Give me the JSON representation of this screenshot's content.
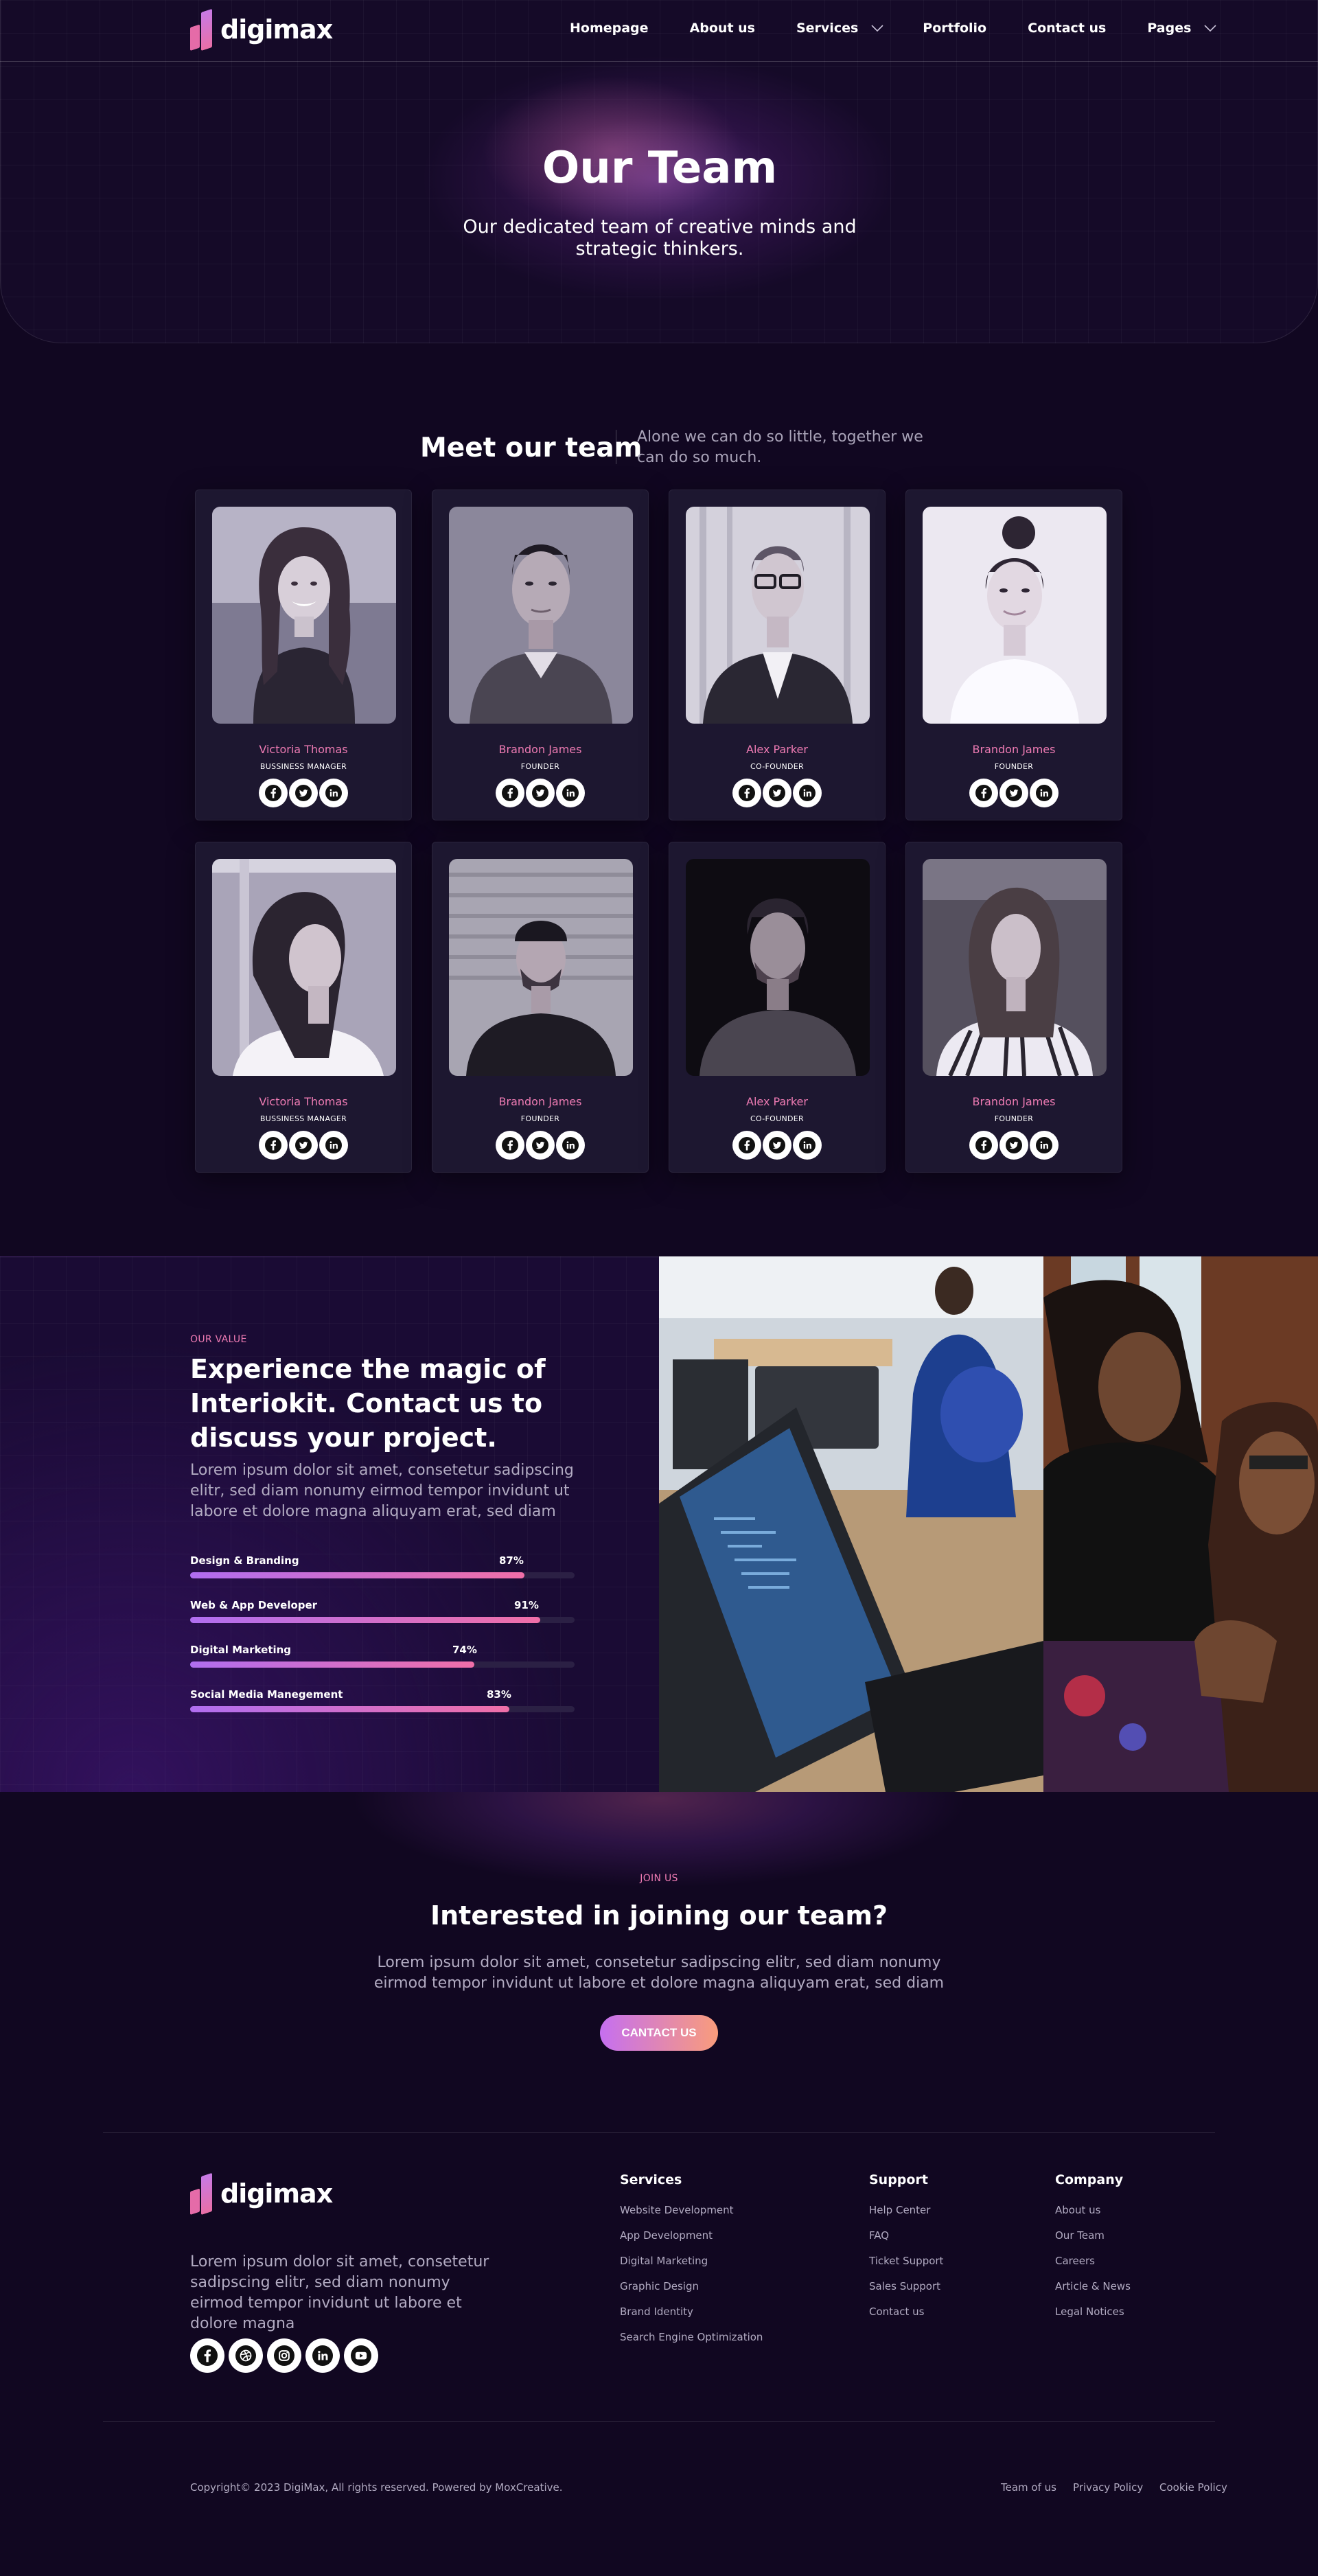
{
  "brand": {
    "name": "digimax"
  },
  "nav": {
    "items": [
      {
        "label": "Homepage",
        "dropdown": false
      },
      {
        "label": "About us",
        "dropdown": false
      },
      {
        "label": "Services",
        "dropdown": true
      },
      {
        "label": "Portfolio",
        "dropdown": false
      },
      {
        "label": "Contact us",
        "dropdown": false
      },
      {
        "label": "Pages",
        "dropdown": true
      }
    ]
  },
  "hero": {
    "title": "Our Team",
    "subtitle": "Our dedicated team of creative minds and strategic thinkers."
  },
  "team": {
    "title": "Meet our team",
    "description": "Alone we can do so little, together we can do so much.",
    "members": [
      {
        "name": "Victoria Thomas",
        "role": "BUSSINESS MANAGER"
      },
      {
        "name": "Brandon James",
        "role": "FOUNDER"
      },
      {
        "name": "Alex Parker",
        "role": "CO-FOUNDER"
      },
      {
        "name": "Brandon James",
        "role": "FOUNDER"
      },
      {
        "name": "Victoria Thomas",
        "role": "BUSSINESS MANAGER"
      },
      {
        "name": "Brandon James",
        "role": "FOUNDER"
      },
      {
        "name": "Alex Parker",
        "role": "CO-FOUNDER"
      },
      {
        "name": "Brandon James",
        "role": "FOUNDER"
      }
    ]
  },
  "value": {
    "eyebrow": "OUR VALUE",
    "title": "Experience the magic of Interiokit. Contact us to discuss your project.",
    "text": "Lorem ipsum dolor sit amet, consetetur sadipscing elitr, sed diam nonumy eirmod tempor invidunt ut labore et dolore magna aliquyam erat, sed diam",
    "skills": [
      {
        "label": "Design & Branding",
        "percent": 87,
        "percent_label": "87%"
      },
      {
        "label": "Web & App Developer",
        "percent": 91,
        "percent_label": "91%"
      },
      {
        "label": "Digital Marketing",
        "percent": 74,
        "percent_label": "74%"
      },
      {
        "label": "Social Media Manegement",
        "percent": 83,
        "percent_label": "83%"
      }
    ]
  },
  "join": {
    "eyebrow": "JOIN US",
    "title": "Interested in joining our team?",
    "text": "Lorem ipsum dolor sit amet, consetetur sadipscing elitr, sed diam nonumy eirmod tempor invidunt ut labore et dolore magna aliquyam erat, sed diam",
    "button": "CANTACT US"
  },
  "footer": {
    "about": "Lorem ipsum dolor sit amet, consetetur sadipscing elitr, sed diam nonumy eirmod tempor invidunt ut labore et dolore magna",
    "social_icons": [
      "facebook-icon",
      "dribbble-icon",
      "instagram-icon",
      "linkedin-icon",
      "youtube-icon"
    ],
    "columns": [
      {
        "title": "Services",
        "links": [
          "Website Development",
          "App Development",
          "Digital Marketing",
          "Graphic Design",
          "Brand Identity",
          "Search Engine Optimization"
        ]
      },
      {
        "title": "Support",
        "links": [
          "Help Center",
          "FAQ",
          "Ticket Support",
          "Sales Support",
          "Contact us"
        ]
      },
      {
        "title": "Company",
        "links": [
          "About us",
          "Our Team",
          "Careers",
          "Article & News",
          "Legal Notices"
        ]
      }
    ],
    "copyright": "Copyright© 2023 DigiMax, All rights reserved. Powered by MoxCreative.",
    "legal_links": [
      "Team of us",
      "Privacy Policy",
      "Cookie Policy"
    ]
  },
  "colors": {
    "background": "#110721",
    "accent_pink": "#ee7bb3",
    "accent_purple": "#b06ef0",
    "card": "#1d1730"
  }
}
